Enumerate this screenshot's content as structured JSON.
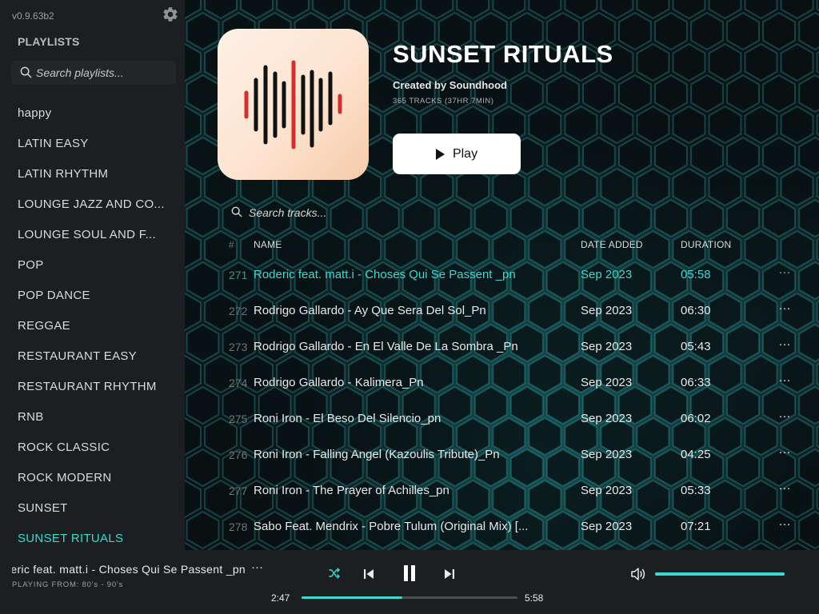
{
  "app": {
    "version": "v0.9.63b2"
  },
  "sidebar": {
    "heading": "PLAYLISTS",
    "search_placeholder": "Search playlists...",
    "items": [
      {
        "label": "happy",
        "active": false
      },
      {
        "label": "LATIN EASY",
        "active": false
      },
      {
        "label": "LATIN RHYTHM",
        "active": false
      },
      {
        "label": "LOUNGE JAZZ AND CO...",
        "active": false
      },
      {
        "label": "LOUNGE SOUL AND F...",
        "active": false
      },
      {
        "label": "POP",
        "active": false
      },
      {
        "label": "POP DANCE",
        "active": false
      },
      {
        "label": "REGGAE",
        "active": false
      },
      {
        "label": "RESTAURANT EASY",
        "active": false
      },
      {
        "label": "RESTAURANT RHYTHM",
        "active": false
      },
      {
        "label": "RNB",
        "active": false
      },
      {
        "label": "ROCK CLASSIC",
        "active": false
      },
      {
        "label": "ROCK MODERN",
        "active": false
      },
      {
        "label": "SUNSET",
        "active": false
      },
      {
        "label": "SUNSET RITUALS",
        "active": true
      }
    ]
  },
  "playlist": {
    "title": "SUNSET RITUALS",
    "creator": "Created by Soundhood",
    "meta": "365 TRACKS (37HR 7MIN)",
    "play_label": "Play",
    "cover_icon": "soundwave-logo-icon"
  },
  "tracks": {
    "search_placeholder": "Search tracks...",
    "headers": {
      "num": "#",
      "name": "NAME",
      "date": "DATE ADDED",
      "duration": "DURATION"
    },
    "more_label": "···",
    "rows": [
      {
        "num": "271",
        "name": "Roderic feat. matt.i - Choses Qui Se Passent _pn",
        "date": "Sep 2023",
        "duration": "05:58",
        "playing": true
      },
      {
        "num": "272",
        "name": "Rodrigo Gallardo - Ay Que Sera Del Sol_Pn",
        "date": "Sep 2023",
        "duration": "06:30",
        "playing": false
      },
      {
        "num": "273",
        "name": "Rodrigo Gallardo - En El Valle De La Sombra _Pn",
        "date": "Sep 2023",
        "duration": "05:43",
        "playing": false
      },
      {
        "num": "274",
        "name": "Rodrigo Gallardo - Kalimera_Pn",
        "date": "Sep 2023",
        "duration": "06:33",
        "playing": false
      },
      {
        "num": "275",
        "name": "Roni Iron - El Beso Del Silencio_pn",
        "date": "Sep 2023",
        "duration": "06:02",
        "playing": false
      },
      {
        "num": "276",
        "name": "Roni Iron - Falling Angel (Kazoulis Tribute)_Pn",
        "date": "Sep 2023",
        "duration": "04:25",
        "playing": false
      },
      {
        "num": "277",
        "name": "Roni Iron - The Prayer of Achilles_pn",
        "date": "Sep 2023",
        "duration": "05:33",
        "playing": false
      },
      {
        "num": "278",
        "name": "Sabo Feat. Mendrix - Pobre Tulum (Original Mix) [...",
        "date": "Sep 2023",
        "duration": "07:21",
        "playing": false
      }
    ]
  },
  "player": {
    "now_playing": "Roderic feat. matt.i - Choses Qui Se Passent _pn",
    "source": "PLAYING FROM: 80's - 90's",
    "more_label": "···",
    "time_current": "2:47",
    "time_total": "5:58",
    "progress_fraction": 0.466,
    "volume_fraction": 1.0
  },
  "colors": {
    "accent": "#3ed8d0",
    "sidebar_bg": "#1c1f21",
    "cover_red": "#d0302e",
    "cover_black": "#111111"
  }
}
